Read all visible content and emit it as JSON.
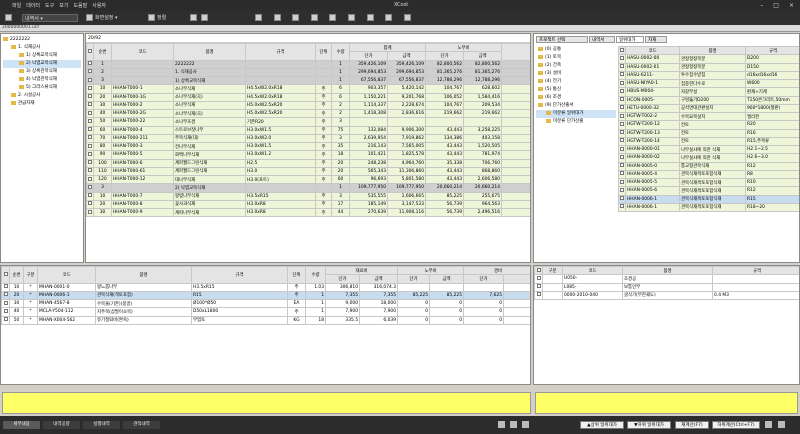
{
  "app": {
    "title": "XCost",
    "menu": [
      "파일",
      "데이터",
      "도구",
      "보기",
      "도움말",
      "사용자"
    ]
  },
  "toolbar": {
    "dropdown": "내역서",
    "settings": "화면설정",
    "sort": "정렬"
  },
  "file": {
    "path": "2000000001.ucf"
  },
  "tree": {
    "items": [
      {
        "label": "2222222",
        "lvl": 0
      },
      {
        "label": "1. 식재공사",
        "lvl": 1
      },
      {
        "label": "1) 상록교목식재",
        "lvl": 2
      },
      {
        "label": "2) 낙엽교목식재",
        "lvl": 2,
        "sel": true
      },
      {
        "label": "3) 상록관목식재",
        "lvl": 2
      },
      {
        "label": "4) 낙엽관목식재",
        "lvl": 2
      },
      {
        "label": "5) 그라스류식재",
        "lvl": 2
      },
      {
        "label": "2. 시설공사",
        "lvl": 1
      },
      {
        "label": "관급자재",
        "lvl": 1
      }
    ]
  },
  "grid": {
    "pager": "20/92",
    "headers": {
      "seq": "순번",
      "code": "코드",
      "name": "품명",
      "spec": "규격",
      "unit": "단위",
      "qty": "수량",
      "total": "합계",
      "labor": "노무비",
      "price": "단가",
      "amount": "금액"
    },
    "rows": [
      {
        "seq": "1",
        "code": "",
        "name": "2222222",
        "spec": "",
        "unit": "",
        "qty": "1",
        "p": "359,426,109",
        "a": "359,426,109",
        "lp": "82,800,562",
        "la": "82,800,562",
        "t": "s"
      },
      {
        "seq": "2",
        "code": "",
        "name": "1. 식재공사",
        "spec": "",
        "unit": "",
        "qty": "1",
        "p": "299,694,853",
        "a": "299,694,853",
        "lp": "81,365,276",
        "la": "81,365,276",
        "t": "s"
      },
      {
        "seq": "3",
        "code": "",
        "name": "1) 상록교목식재",
        "spec": "",
        "unit": "",
        "qty": "1",
        "p": "67,556,837",
        "a": "67,556,837",
        "lp": "12,788,296",
        "la": "12,788,296",
        "t": "s"
      },
      {
        "seq": "10",
        "code": "HHAN-T000-1",
        "name": "소나무식재",
        "spec": "H4.5xW2.0xR18",
        "unit": "주",
        "qty": "6",
        "p": "903,357",
        "a": "5,420,142",
        "lp": "104,767",
        "la": "628,602",
        "t": "g"
      },
      {
        "seq": "20",
        "code": "HHAN-T000-1G",
        "name": "소나무식재(곡)",
        "spec": "H4.5xW2.0xR18",
        "unit": "주",
        "qty": "6",
        "p": "1,150,221",
        "a": "9,201,768",
        "lp": "106,052",
        "la": "1,584,416",
        "t": "g"
      },
      {
        "seq": "30",
        "code": "HHAN-T000-2",
        "name": "소나무식재",
        "spec": "H5.0xW2.5xR20",
        "unit": "주",
        "qty": "2",
        "p": "1,114,337",
        "a": "2,228,674",
        "lp": "104,767",
        "la": "209,534",
        "t": "g"
      },
      {
        "seq": "40",
        "code": "HHAN-T000-2G",
        "name": "소나무식재(곡)",
        "spec": "H5.0xW2.5xR20",
        "unit": "주",
        "qty": "2",
        "p": "1,418,308",
        "a": "2,836,616",
        "lp": "219,662",
        "la": "219,662",
        "t": "g"
      },
      {
        "seq": "50",
        "code": "HHAN-T000-22",
        "name": "소나무조경",
        "spec": "기존R20",
        "unit": "주",
        "qty": "3",
        "p": "",
        "a": "",
        "lp": "",
        "la": "",
        "t": "g"
      },
      {
        "seq": "60",
        "code": "HHAN-T000-4",
        "name": "스트로브잣나무",
        "spec": "H3.0xW1.5",
        "unit": "주",
        "qty": "75",
        "p": "132,084",
        "a": "9,906,300",
        "lp": "43,443",
        "la": "3,258,225",
        "t": "g"
      },
      {
        "seq": "70",
        "code": "HHAN-T000-211",
        "name": "주목식재(대)",
        "spec": "H3.0xW2.0",
        "unit": "주",
        "qty": "3",
        "p": "2,639,954",
        "a": "7,919,862",
        "lp": "134,386",
        "la": "403,158",
        "t": "g"
      },
      {
        "seq": "80",
        "code": "HHAN-T000-3",
        "name": "전나무식재",
        "spec": "H3.0xW1.5",
        "unit": "주",
        "qty": "35",
        "p": "216,143",
        "a": "7,565,005",
        "lp": "43,443",
        "la": "1,520,505",
        "t": "g"
      },
      {
        "seq": "90",
        "code": "HHAN-T000-5",
        "name": "화백나무식재",
        "spec": "H3.0xW1.2",
        "unit": "주",
        "qty": "18",
        "p": "101,421",
        "a": "1,825,578",
        "lp": "43,443",
        "la": "781,974",
        "t": "g"
      },
      {
        "seq": "100",
        "code": "HHAN-T000-6",
        "name": "계피월드그린식재",
        "spec": "H2.5",
        "unit": "주",
        "qty": "20",
        "p": "248,238",
        "a": "4,964,760",
        "lp": "35,338",
        "la": "706,760",
        "t": "g"
      },
      {
        "seq": "110",
        "code": "HHAN-T000-61",
        "name": "계피월드그린식재",
        "spec": "H3.0",
        "unit": "주",
        "qty": "20",
        "p": "565,343",
        "a": "11,306,860",
        "lp": "43,443",
        "la": "868,860",
        "t": "g"
      },
      {
        "seq": "120",
        "code": "HHAN-T000-12",
        "name": "대나무식재",
        "spec": "H3.0(포트)",
        "unit": "주",
        "qty": "60",
        "p": "96,693",
        "a": "5,801,580",
        "lp": "43,443",
        "la": "2,606,580",
        "t": "g"
      },
      {
        "seq": "3",
        "code": "",
        "name": "2) 낙엽교목식재",
        "spec": "",
        "unit": "",
        "qty": "1",
        "p": "109,777,950",
        "a": "109,777,950",
        "lp": "20,660,214",
        "la": "20,660,214",
        "t": "s"
      },
      {
        "seq": "10",
        "code": "HHAN-T000-7",
        "name": "왕벚나무식재",
        "spec": "H3.5xR15",
        "unit": "주",
        "qty": "3",
        "p": "535,555",
        "a": "1,606,665",
        "lp": "85,225",
        "la": "255,675",
        "t": "g"
      },
      {
        "seq": "20",
        "code": "HHAN-T000-8",
        "name": "꽃사과식재",
        "spec": "H3.0xR8",
        "unit": "주",
        "qty": "17",
        "p": "185,149",
        "a": "3,147,533",
        "lp": "56,739",
        "la": "964,563",
        "t": "g"
      },
      {
        "seq": "30",
        "code": "HHAN-T000-9",
        "name": "계피나무식재",
        "spec": "H3.0xR8",
        "unit": "주",
        "qty": "44",
        "p": "270,639",
        "a": "11,908,116",
        "lp": "56,739",
        "la": "2,496,516",
        "t": "g"
      }
    ]
  },
  "detail": {
    "headers": {
      "seq": "순번",
      "type": "구분",
      "code": "코드",
      "name": "품명",
      "spec": "규격",
      "unit": "단위",
      "qty": "수량",
      "mat": "재료비",
      "labor": "노무비",
      "exp": "경비",
      "price": "단가",
      "amount": "금액"
    },
    "rows": [
      {
        "seq": "10",
        "type": "*",
        "code": "MHAN-0001-0",
        "name": "왕느릅나무",
        "spec": "H3.5xR15",
        "unit": "주",
        "qty": "1.03",
        "mp": "306,810",
        "ma": "316,074.3",
        "lp": "",
        "la": "",
        "ep": ""
      },
      {
        "seq": "20",
        "type": "*",
        "code": "MHAN-0006-1",
        "name": "관목식재(객토포함)",
        "spec": "R15",
        "unit": "주",
        "qty": "1",
        "mp": "7,355",
        "ma": "7,355",
        "lp": "85,225",
        "la": "85,225",
        "ep": "7,625",
        "sel": true
      },
      {
        "seq": "30",
        "type": "*",
        "code": "MHAN-4567-8",
        "name": "수목울(기존)(몽골)",
        "spec": "Ø100*Ø50",
        "unit": "EA",
        "qty": "1",
        "mp": "9,000",
        "ma": "18,000",
        "lp": "0",
        "la": "0",
        "ep": "0"
      },
      {
        "seq": "40",
        "type": "*",
        "code": "MCLA-Y504-112",
        "name": "지주목(삼발이소목)",
        "spec": "D50xL1800",
        "unit": "주",
        "qty": "1",
        "mp": "7,900",
        "ma": "7,900",
        "lp": "0",
        "la": "0",
        "ep": "0"
      },
      {
        "seq": "50",
        "type": "*",
        "code": "MHAN-X004-562",
        "name": "유기질퇴비(완숙)",
        "spec": "부엽토",
        "unit": "KG",
        "qty": "18",
        "mp": "335.5",
        "ma": "6,039",
        "lp": "0",
        "la": "0",
        "ep": "0"
      }
    ]
  },
  "right": {
    "tabs": [
      "프로젝트 선택",
      "내역서",
      "일위대가",
      "자재"
    ],
    "tree": [
      {
        "label": "(0) 공통",
        "lvl": 0
      },
      {
        "label": "(1) 토목",
        "lvl": 0
      },
      {
        "label": "(2) 건축",
        "lvl": 0
      },
      {
        "label": "(3) 설비",
        "lvl": 0
      },
      {
        "label": "(4) 전기",
        "lvl": 0
      },
      {
        "label": "(5) 통신",
        "lvl": 0
      },
      {
        "label": "(6) 조경",
        "lvl": 0
      },
      {
        "label": "(9) 단가산출서",
        "lvl": 0
      },
      {
        "label": "미분류 일위대가",
        "lvl": 1,
        "sel": true
      },
      {
        "label": "미분류 단가산출",
        "lvl": 1
      }
    ],
    "headers": {
      "code": "코드",
      "name": "품명",
      "spec": "규격"
    },
    "rows": [
      {
        "code": "HASU-0002-00",
        "name": "관정형정목분",
        "spec": "D200"
      },
      {
        "code": "HASU-0002-01",
        "name": "관정형정목분",
        "spec": "D150"
      },
      {
        "code": "HASU-6211-",
        "name": "투수집수받침",
        "spec": "d16xd16xd16"
      },
      {
        "code": "HASU-NIYA0-1",
        "name": "집중한다수로",
        "spec": "W600"
      },
      {
        "code": "HBUS-M004-",
        "name": "자갈부설",
        "spec": "판재+기계"
      },
      {
        "code": "HCON-0005-",
        "name": "구멍뚫기D200",
        "spec": "T150콘크리트,50mm"
      },
      {
        "code": "HETU-0000-32",
        "name": "공석면대관판설치",
        "spec": "900*1800(철판)"
      },
      {
        "code": "HGTW-T002-2",
        "name": "수목묘목설치",
        "spec": "엘리펀"
      },
      {
        "code": "HGTW-T200-12",
        "name": "전토",
        "spec": "R20"
      },
      {
        "code": "HGTW-T200-13",
        "name": "전토",
        "spec": "R16"
      },
      {
        "code": "HGTW-T200-14",
        "name": "전토",
        "spec": "R15,주목류"
      },
      {
        "code": "HHAN-0000-01",
        "name": "나무실사에 의한 식재",
        "spec": "H2.1~2.5"
      },
      {
        "code": "HHAN-0000-02",
        "name": "나무실사에 의한 식재",
        "spec": "H2.6~3.0"
      },
      {
        "code": "HHAN-0005-0",
        "name": "통교형관목식재",
        "spec": "R12"
      },
      {
        "code": "HHAN-0005-4",
        "name": "관목식재객토포함식재",
        "spec": "R8"
      },
      {
        "code": "HHAN-0005-5",
        "name": "관목식재객토포함식재",
        "spec": "R10"
      },
      {
        "code": "HHAN-0005-6",
        "name": "관목식재객토포함식재",
        "spec": "R12"
      },
      {
        "code": "HHAN-0006-1",
        "name": "관목식재객토포함식재",
        "spec": "R15",
        "sel": true
      },
      {
        "code": "HHAN-0006-1",
        "name": "관목식재객토포함식재",
        "spec": "R18~20"
      }
    ]
  },
  "right_detail": {
    "headers": {
      "type": "구분",
      "code": "코드",
      "name": "품명",
      "spec": "규격"
    },
    "rows": [
      {
        "type": "",
        "code": "U050-",
        "name": "조경공",
        "spec": ""
      },
      {
        "type": "",
        "code": "L085-",
        "name": "보통인부",
        "spec": ""
      },
      {
        "type": "",
        "code": "0000-2010-040",
        "name": "굴삭기(무한궤도)",
        "spec": "0.4 M3"
      }
    ]
  },
  "buttons": {
    "up": "▲상위 일위대가",
    "down": "▼하위 일위대가",
    "recalc": "재계산(F7)",
    "calc": "하위계산(Ctrl+F7)"
  },
  "bottom_tabs": [
    "세부내용",
    "내역공량",
    "실행내역",
    "견적내역"
  ]
}
